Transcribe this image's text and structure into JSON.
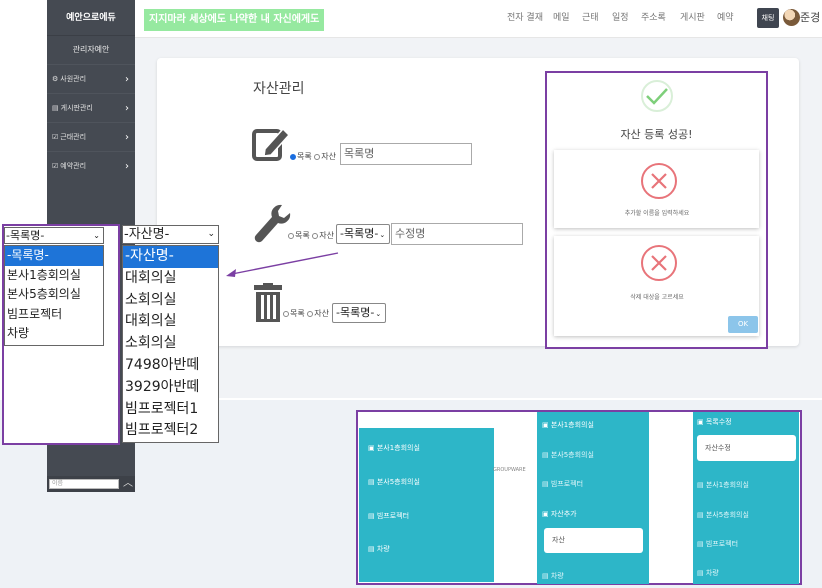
{
  "sidebar": {
    "brand": "예안으로에듀",
    "user": "관리자예안",
    "items": [
      {
        "icon": "⚙",
        "label": "사원관리"
      },
      {
        "icon": "▤",
        "label": "게시판관리"
      },
      {
        "icon": "☑",
        "label": "근태관리"
      },
      {
        "icon": "☑",
        "label": "예약관리"
      }
    ],
    "search_placeholder": "이름"
  },
  "header": {
    "marquee": "지지마라 세상에도 나약한 내 자신에게도",
    "nav": [
      "전자 결재",
      "메일",
      "근태",
      "일정",
      "주소록",
      "게시판",
      "예약"
    ],
    "chat_label": "채팅",
    "user_name": "준경"
  },
  "asset_page": {
    "title": "자산관리",
    "register_row": {
      "radio_list": "목록",
      "radio_asset": "자산",
      "input_placeholder": "목록명"
    },
    "edit_row": {
      "radio_list": "목록",
      "radio_asset": "자산",
      "select_value": "-목록명-",
      "input_placeholder": "수정명"
    },
    "delete_row": {
      "radio_list": "목록",
      "radio_asset": "자산",
      "select_value": "-목록명-"
    }
  },
  "modal": {
    "success_title": "자산 등록 성공!",
    "error_name": "추가할 이름을 입력하세요",
    "error_delete": "삭제 대상을 고르세요",
    "ok_label": "OK"
  },
  "list_dropdown": {
    "selected": "-목록명-",
    "options": [
      "-목록명-",
      "본사1층회의실",
      "본사5층회의실",
      "빔프로젝터",
      "차량"
    ]
  },
  "asset_dropdown": {
    "selected": "-자산명-",
    "options": [
      "-자산명-",
      "대회의실",
      "소회의실",
      "대회의실",
      "소회의실",
      "7498아반떼",
      "3929아반떼",
      "빔프로젝터1",
      "빔프로젝터2"
    ]
  },
  "panel_a": {
    "items": [
      "본사1층회의실",
      "본사5층회의실",
      "빔프로젝터",
      "차량"
    ]
  },
  "groupware": "GROUPWARE",
  "panel_b": {
    "items_top": [
      "본사1층회의실",
      "본사5층회의실",
      "빔프로젝터"
    ],
    "add_label": "자산추가",
    "input_value": "자산",
    "items_bottom": [
      "차량"
    ]
  },
  "panel_c": {
    "edit_label": "목록수정",
    "input_value": "자산수정",
    "items": [
      "본사1층회의실",
      "본사5층회의실",
      "빔프로젝터",
      "차량"
    ]
  },
  "colors": {
    "sidebar": "#454a52",
    "accent_purple": "#7b3fa3",
    "teal": "#2db6c8",
    "marquee_green": "#96e9a0",
    "select_blue": "#1e74d8",
    "success_green": "#7ecf7a",
    "error_red": "#e8747a"
  }
}
